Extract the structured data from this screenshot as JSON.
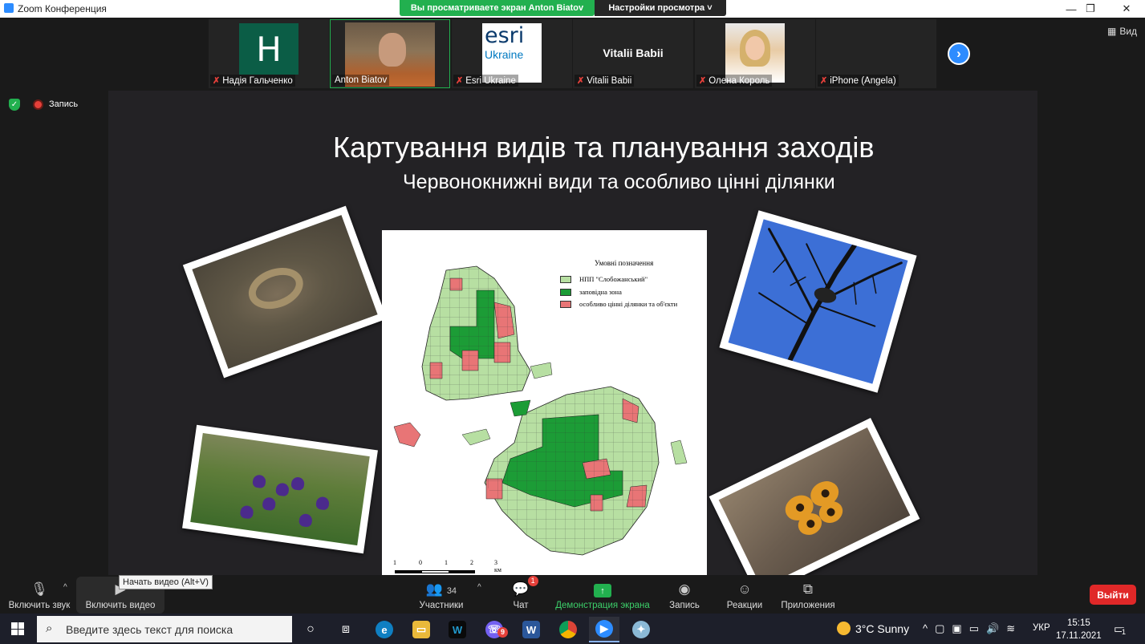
{
  "window": {
    "title": "Zoom Конференция",
    "share_banner": "Вы просматриваете экран Anton Biatov",
    "view_settings": "Настройки просмотра ˅",
    "controls": [
      "—",
      "❐",
      "✕"
    ]
  },
  "participants": [
    {
      "name": "Надія Гальченко",
      "muted": true,
      "avatar_letter": "H"
    },
    {
      "name": "Anton Biatov",
      "muted": false
    },
    {
      "name": "Esri Ukraine",
      "muted": true,
      "logo_line1": "esri",
      "logo_line2": "Ukraine"
    },
    {
      "name": "Vitalii Babii",
      "muted": true,
      "big_name": "Vitalii Babii"
    },
    {
      "name": "Олена Король",
      "muted": true
    },
    {
      "name": "iPhone (Angela)",
      "muted": true
    }
  ],
  "view_button": "Вид",
  "recording_label": "Запись",
  "slide": {
    "title": "Картування видів та планування заходів",
    "subtitle": "Червонокнижні види  та особливо цінні ділянки",
    "map": {
      "legend_title": "Умовні позначення",
      "legend": [
        {
          "label": "НПП \"Слобожанський\"",
          "color": "#b7dfa2"
        },
        {
          "label": "заповідна зона",
          "color": "#1c9c36"
        },
        {
          "label": "особливо цінні ділянки та об'єкти",
          "color": "#e87576"
        }
      ],
      "scale_labels": [
        "1",
        "0",
        "1",
        "2",
        "3 км"
      ]
    }
  },
  "toolbar": {
    "unmute": "Включить звук",
    "start_video": "Включить видео",
    "tooltip": "Начать видео (Alt+V)",
    "participants": "Участники",
    "participants_count": "34",
    "chat": "Чат",
    "chat_badge": "1",
    "share_screen": "Демонстрация экрана",
    "record": "Запись",
    "reactions": "Реакции",
    "apps": "Приложения",
    "leave": "Выйти"
  },
  "taskbar": {
    "search_placeholder": "Введите здесь текст для поиска",
    "weather": "3°C  Sunny",
    "language": "УКР",
    "time": "15:15",
    "date": "17.11.2021",
    "notifications": "1",
    "viber_badge": "9"
  }
}
